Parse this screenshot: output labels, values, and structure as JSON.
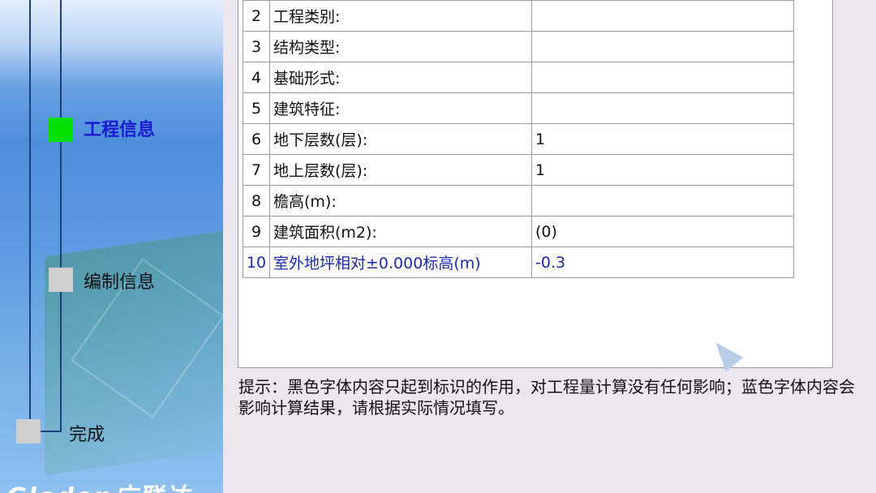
{
  "sidebar": {
    "steps": [
      {
        "label": "工程信息",
        "state": "current",
        "color": "#1a1ad0",
        "square_color": "#00e000"
      },
      {
        "label": "编制信息",
        "state": "pending",
        "color": "#111111",
        "square_color": "#cfcfcf"
      },
      {
        "label": "完成",
        "state": "pending",
        "color": "#111111",
        "square_color": "#cfcfcf"
      }
    ],
    "logo_text": "Glodon广联达"
  },
  "table": {
    "rows": [
      {
        "no": "2",
        "name": "工程类别:",
        "value": "",
        "affects_calc": false
      },
      {
        "no": "3",
        "name": "结构类型:",
        "value": "",
        "affects_calc": false
      },
      {
        "no": "4",
        "name": "基础形式:",
        "value": "",
        "affects_calc": false
      },
      {
        "no": "5",
        "name": "建筑特征:",
        "value": "",
        "affects_calc": false
      },
      {
        "no": "6",
        "name": "地下层数(层):",
        "value": "1",
        "affects_calc": false
      },
      {
        "no": "7",
        "name": "地上层数(层):",
        "value": "1",
        "affects_calc": false
      },
      {
        "no": "8",
        "name": "檐高(m):",
        "value": "",
        "affects_calc": false
      },
      {
        "no": "9",
        "name": "建筑面积(m2):",
        "value": "(0)",
        "affects_calc": false
      },
      {
        "no": "10",
        "name": "室外地坪相对±0.000标高(m)",
        "value": "-0.3",
        "affects_calc": true
      }
    ]
  },
  "hint": "提示：黑色字体内容只起到标识的作用，对工程量计算没有任何影响；蓝色字体内容会影响计算结果，请根据实际情况填写。",
  "colors": {
    "blue_text": "#1a2bb0",
    "black_text": "#111111",
    "current_step": "#1a1ad0"
  }
}
